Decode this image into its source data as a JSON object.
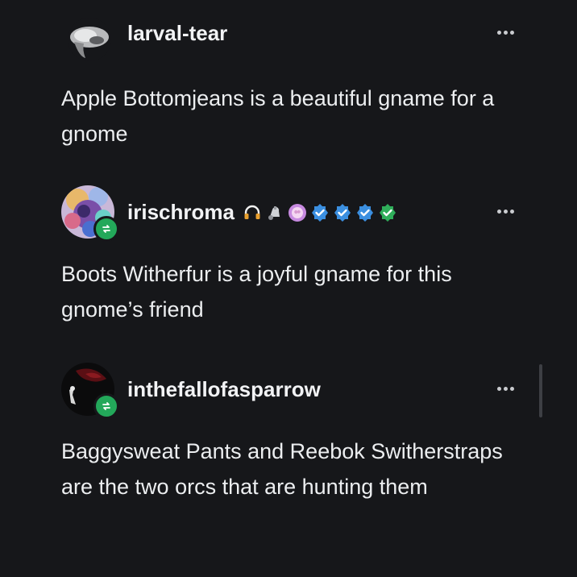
{
  "posts": [
    {
      "username": "larval-tear",
      "text": "Apple Bottomjeans is a beautiful gname for a gnome",
      "reblogged": false,
      "badges": []
    },
    {
      "username": "irischroma",
      "text": "Boots Witherfur is a joyful gname for this gnome’s friend",
      "reblogged": true,
      "badges": [
        "headphones-icon",
        "bell-icon",
        "brain-icon",
        "blue-verified-icon",
        "blue-verified-icon",
        "blue-verified-icon",
        "green-verified-icon"
      ]
    },
    {
      "username": "inthefallofasparrow",
      "text": "Baggysweat Pants and Reebok Switherstraps are the two orcs that are hunting them",
      "reblogged": true,
      "badges": []
    }
  ],
  "colors": {
    "background": "#16171a",
    "text": "#eceef0",
    "reblog_green": "#23a85a",
    "verified_blue": "#3b8fe0",
    "verified_green": "#2fae5a"
  }
}
